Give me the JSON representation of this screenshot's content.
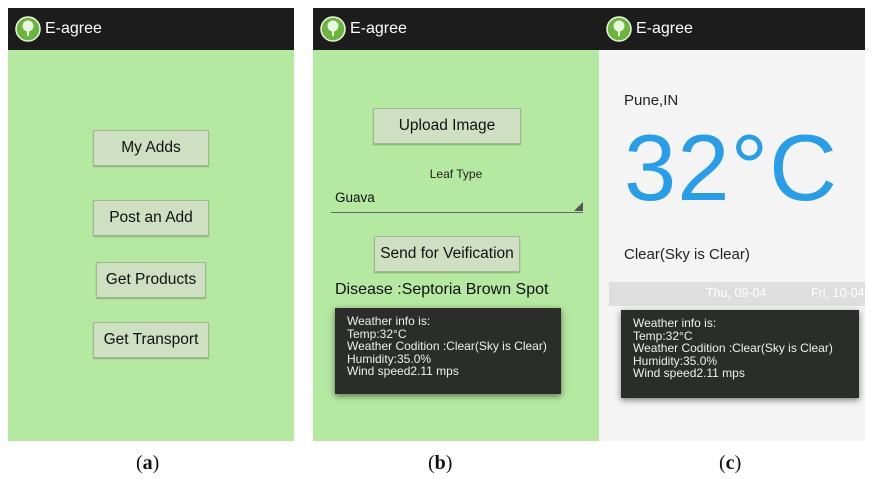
{
  "app": {
    "title": "E-agree"
  },
  "panels": {
    "a": {
      "caption_open": "(",
      "caption_letter": "a",
      "caption_close": ")",
      "buttons": [
        "My Adds",
        "Post an Add",
        "Get Products",
        "Get Transport"
      ]
    },
    "b": {
      "caption_open": "(",
      "caption_letter": "b",
      "caption_close": ")",
      "upload_label": "Upload Image",
      "leaf_type_label": "Leaf Type",
      "leaf_type_value": "Guava",
      "send_label": "Send for Veification",
      "disease_text": "Disease :Septoria Brown Spot",
      "toast": {
        "line1": "Weather info is:",
        "line2": "Temp:32°C",
        "line3": "Weather Codition :Clear(Sky is Clear)",
        "line4": "Humidity:35.0%",
        "line5": "Wind speed2.11 mps"
      }
    },
    "c": {
      "caption_open": "(",
      "caption_letter": "c",
      "caption_close": ")",
      "city": "Pune,IN",
      "temperature": "32°C",
      "condition": "Clear(Sky is Clear)",
      "days": [
        "Thu, 09-04",
        "Fri, 10-04"
      ],
      "toast": {
        "line1": "Weather info is:",
        "line2": "Temp:32°C",
        "line3": "Weather Codition :Clear(Sky is Clear)",
        "line4": "Humidity:35.0%",
        "line5": "Wind speed2.11 mps"
      }
    }
  },
  "colors": {
    "appbar": "#1c1c1c",
    "screen_green": "#b5e8a1",
    "button": "#cfe0c2",
    "temperature_blue": "#2a9de8",
    "toast_bg": "#2b2d2a"
  },
  "icons": {
    "app_logo": "tree-logo-icon",
    "spinner": "spinner-triangle-icon"
  }
}
